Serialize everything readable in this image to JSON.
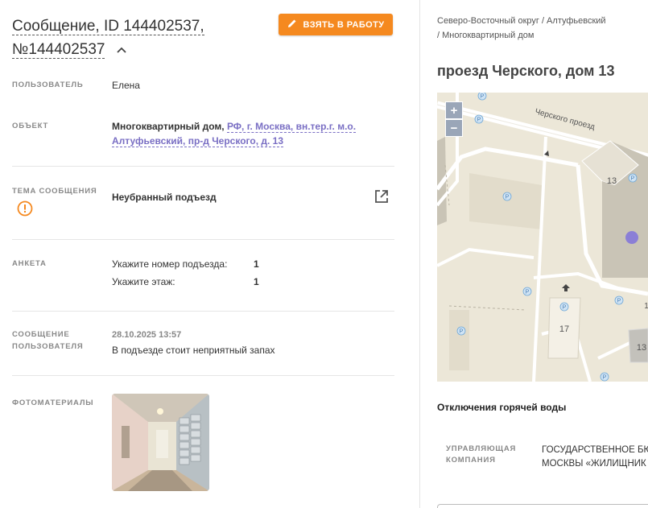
{
  "message": {
    "title_line1": "Сообщение, ID 144402537,",
    "title_line2": "№144402537",
    "take_button": "ВЗЯТЬ В РАБОТУ"
  },
  "fields": {
    "user_label": "ПОЛЬЗОВАТЕЛЬ",
    "user_value": "Елена",
    "object_label": "ОБЪЕКТ",
    "object_type": "Многоквартирный дом,",
    "object_address_1": "РФ, г. Москва, вн.тер.г. м.о.",
    "object_address_2": "Алтуфьевский, пр-д Черского, д. 13",
    "topic_label": "ТЕМА СООБЩЕНИЯ",
    "topic_value": "Неубранный подъезд",
    "survey_label": "АНКЕТА",
    "survey": [
      {
        "q": "Укажите номер подъезда:",
        "a": "1"
      },
      {
        "q": "Укажите этаж:",
        "a": "1"
      }
    ],
    "msg_label_1": "СООБЩЕНИЕ",
    "msg_label_2": "ПОЛЬЗОВАТЕЛЯ",
    "msg_date": "28.10.2025 13:57",
    "msg_text": "В подъезде стоит неприятный запах",
    "photo_label": "ФОТОМАТЕРИАЛЫ"
  },
  "right": {
    "breadcrumb_1": "Северо-Восточный округ / Алтуфьевский",
    "breadcrumb_2": "/ Многоквартирный дом",
    "address": "проезд Черского, дом 13",
    "map": {
      "zoom_in": "+",
      "zoom_out": "−",
      "street": "Черского проезд",
      "house_1": "13",
      "house_2": "17",
      "house_3": "13",
      "house_4": "1",
      "poi": "P"
    },
    "hot_water": "Отключения горячей воды",
    "mc_label_1": "УПРАВЛЯЮЩАЯ",
    "mc_label_2": "КОМПАНИЯ",
    "mc_value_1": "ГОСУДАРСТВЕННОЕ БЮ",
    "mc_value_2": "МОСКВЫ «ЖИЛИЩНИК"
  },
  "colors": {
    "accent": "#f5891f",
    "link": "#7a6fc4",
    "marker": "#8b7fd6"
  }
}
